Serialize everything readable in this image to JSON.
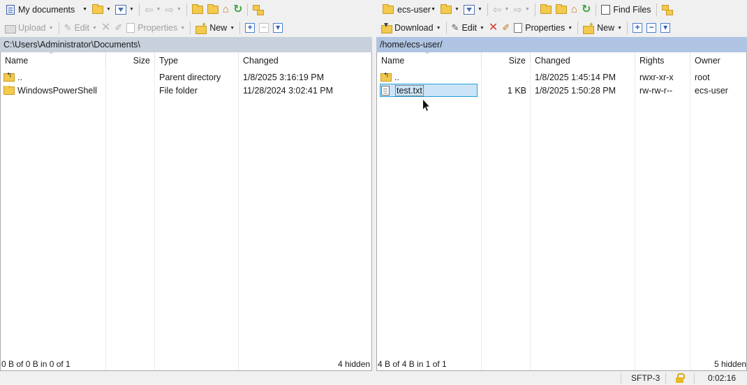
{
  "left": {
    "location": "My documents",
    "toolbar": {
      "upload": "Upload",
      "edit": "Edit",
      "properties": "Properties",
      "new": "New"
    },
    "path": "C:\\Users\\Administrator\\Documents\\",
    "columns": [
      "Name",
      "Size",
      "Type",
      "Changed"
    ],
    "rows": [
      {
        "name": "..",
        "size": "",
        "type": "Parent directory",
        "changed": "1/8/2025 3:16:19 PM"
      },
      {
        "name": "WindowsPowerShell",
        "size": "",
        "type": "File folder",
        "changed": "11/28/2024 3:02:41 PM"
      }
    ],
    "status": "0 B of 0 B in 0 of 1",
    "hidden": "4 hidden"
  },
  "right": {
    "location": "ecs-user",
    "toolbar": {
      "find_files": "Find Files",
      "download": "Download",
      "edit": "Edit",
      "properties": "Properties",
      "new": "New"
    },
    "path": "/home/ecs-user/",
    "columns": [
      "Name",
      "Size",
      "Changed",
      "Rights",
      "Owner"
    ],
    "rows": [
      {
        "name": "..",
        "size": "",
        "changed": "1/8/2025 1:45:14 PM",
        "rights": "rwxr-xr-x",
        "owner": "root"
      },
      {
        "name": "test.txt",
        "size": "1 KB",
        "changed": "1/8/2025 1:50:28 PM",
        "rights": "rw-rw-r--",
        "owner": "ecs-user"
      }
    ],
    "status": "4 B of 4 B in 1 of 1",
    "hidden": "5 hidden"
  },
  "bottom": {
    "protocol": "SFTP-3",
    "time": "0:02:16"
  },
  "colors": {
    "left_path_bg": "#c8d0dc",
    "right_path_bg": "#aec4e2",
    "selection": "#cce4f7",
    "folder": "#f3c94e"
  }
}
